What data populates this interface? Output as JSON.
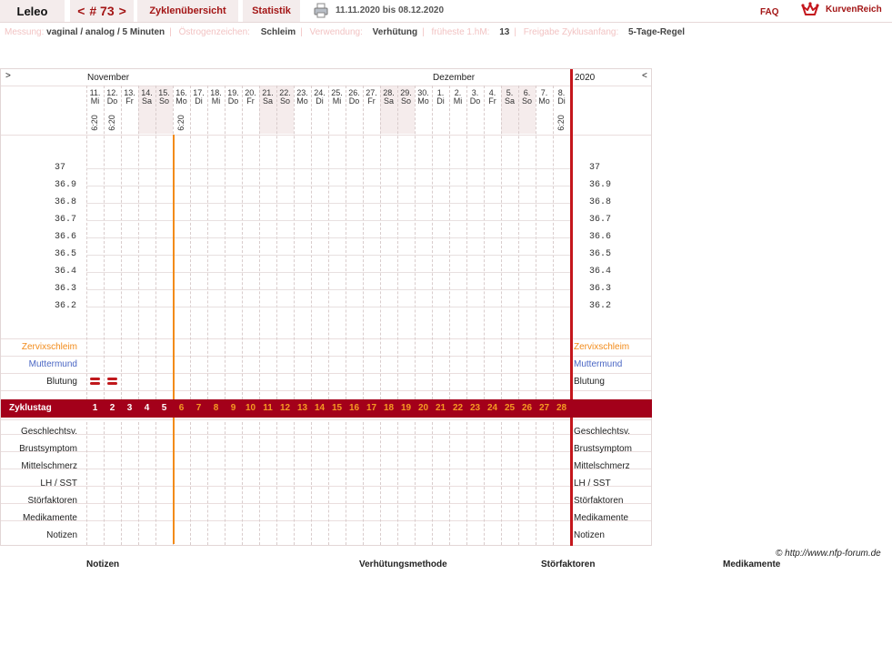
{
  "header": {
    "user": "Leleo",
    "cycle_prev": "<",
    "cycle_num": "# 73",
    "cycle_next": ">",
    "tab_overview": "Zyklenübersicht",
    "tab_stats": "Statistik",
    "date_range": "11.11.2020 bis 08.12.2020",
    "faq": "FAQ",
    "brand": "KurvenReich"
  },
  "info": [
    {
      "label": "Messung:",
      "value": "vaginal / analog / 5 Minuten"
    },
    {
      "label": "Östrogenzeichen:",
      "value": "Schleim"
    },
    {
      "label": "Verwendung:",
      "value": "Verhütung"
    },
    {
      "label": "früheste 1.hM:",
      "value": "13"
    },
    {
      "label": "Freigabe Zyklusanfang:",
      "value": "5-Tage-Regel"
    }
  ],
  "chart": {
    "nav_left": ">",
    "nav_right": "<",
    "month_1": "November",
    "month_2": "Dezember",
    "year": "2020",
    "days": [
      {
        "date": "11.",
        "wd": "Mi",
        "time": "6:20"
      },
      {
        "date": "12.",
        "wd": "Do",
        "time": "6:20"
      },
      {
        "date": "13.",
        "wd": "Fr",
        "time": ""
      },
      {
        "date": "14.",
        "wd": "Sa",
        "time": ""
      },
      {
        "date": "15.",
        "wd": "So",
        "time": ""
      },
      {
        "date": "16.",
        "wd": "Mo",
        "time": "6:20"
      },
      {
        "date": "17.",
        "wd": "Di",
        "time": ""
      },
      {
        "date": "18.",
        "wd": "Mi",
        "time": ""
      },
      {
        "date": "19.",
        "wd": "Do",
        "time": ""
      },
      {
        "date": "20.",
        "wd": "Fr",
        "time": ""
      },
      {
        "date": "21.",
        "wd": "Sa",
        "time": ""
      },
      {
        "date": "22.",
        "wd": "So",
        "time": ""
      },
      {
        "date": "23.",
        "wd": "Mo",
        "time": ""
      },
      {
        "date": "24.",
        "wd": "Di",
        "time": ""
      },
      {
        "date": "25.",
        "wd": "Mi",
        "time": ""
      },
      {
        "date": "26.",
        "wd": "Do",
        "time": ""
      },
      {
        "date": "27.",
        "wd": "Fr",
        "time": ""
      },
      {
        "date": "28.",
        "wd": "Sa",
        "time": ""
      },
      {
        "date": "29.",
        "wd": "So",
        "time": ""
      },
      {
        "date": "30.",
        "wd": "Mo",
        "time": ""
      },
      {
        "date": "1.",
        "wd": "Di",
        "time": ""
      },
      {
        "date": "2.",
        "wd": "Mi",
        "time": ""
      },
      {
        "date": "3.",
        "wd": "Do",
        "time": ""
      },
      {
        "date": "4.",
        "wd": "Fr",
        "time": ""
      },
      {
        "date": "5.",
        "wd": "Sa",
        "time": ""
      },
      {
        "date": "6.",
        "wd": "So",
        "time": ""
      },
      {
        "date": "7.",
        "wd": "Mo",
        "time": ""
      },
      {
        "date": "8.",
        "wd": "Di",
        "time": "6:20"
      }
    ],
    "temps": [
      "37",
      "36.9",
      "36.8",
      "36.7",
      "36.6",
      "36.5",
      "36.4",
      "36.3",
      "36.2"
    ],
    "rows_upper": [
      "Zervixschleim",
      "Muttermund",
      "Blutung"
    ],
    "cycle_label": "Zyklustag",
    "cycle_days": [
      "1",
      "2",
      "3",
      "4",
      "5",
      "6",
      "7",
      "8",
      "9",
      "10",
      "11",
      "12",
      "13",
      "14",
      "15",
      "16",
      "17",
      "18",
      "19",
      "20",
      "21",
      "22",
      "23",
      "24",
      "25",
      "26",
      "27",
      "28"
    ],
    "rows_lower": [
      "Geschlechtsv.",
      "Brustsymptom",
      "Mittelschmerz",
      "LH / SST",
      "Störfaktoren",
      "Medikamente",
      "Notizen"
    ],
    "bleeding_days": [
      1,
      2
    ],
    "weekend_cols": [
      3,
      4,
      10,
      11,
      17,
      18,
      24,
      25
    ]
  },
  "colors": {
    "accent": "#a31515",
    "cycle_bar": "#a3001a",
    "cycle_day_white": "#ffffff",
    "cycle_day_orange": "#f59a23",
    "zervix": "#f28b1a",
    "muttermund": "#4a66c4",
    "bleeding": "#c0181c",
    "weekend": "#f5ecec"
  },
  "copyright": "© http://www.nfp-forum.de",
  "footer": [
    "Notizen",
    "Verhütungsmethode",
    "Störfaktoren",
    "Medikamente"
  ]
}
